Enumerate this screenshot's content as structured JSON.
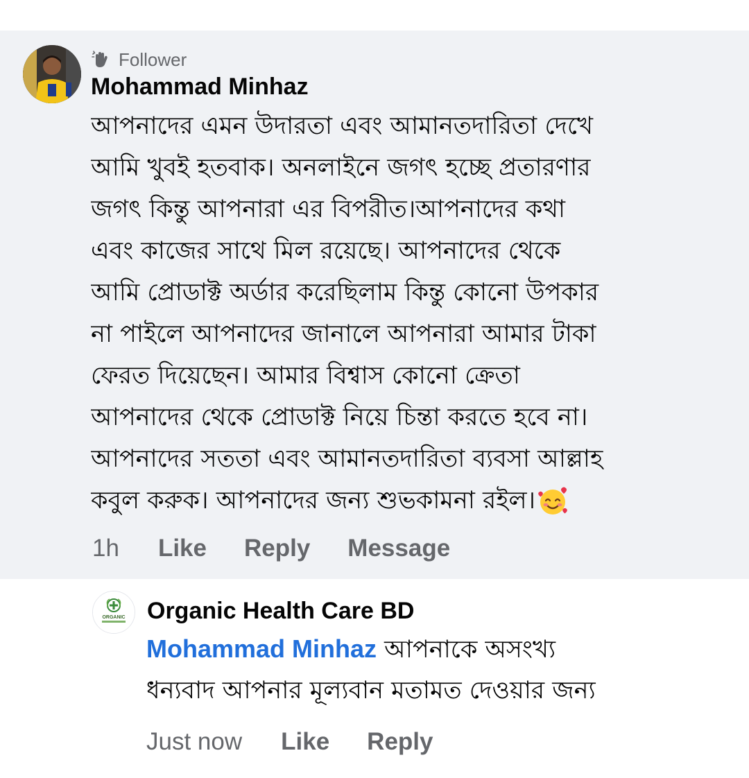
{
  "comment": {
    "badge": "Follower",
    "author": "Mohammad Minhaz",
    "lines": [
      "আপনাদের এমন উদারতা এবং আমানতদারিতা দেখে",
      "আমি খুবই হতবাক। অনলাইনে জগৎ হচ্ছে প্রতারণার",
      "জগৎ কিন্তু আপনারা এর বিপরীত।আপনাদের কথা",
      "এবং কাজের সাথে মিল রয়েছে। আপনাদের থেকে",
      "আমি প্রোডাক্ট অর্ডার করেছিলাম কিন্তু কোনো উপকার",
      "না পাইলে আপনাদের জানালে আপনারা আমার টাকা",
      "ফেরত দিয়েছেন। আমার বিশ্বাস কোনো ক্রেতা",
      "আপনাদের থেকে প্রোডাক্ট নিয়ে চিন্তা করতে হবে না।",
      "আপনাদের সততা এবং আমানতদারিতা ব্যবসা আল্লাহ",
      "কবুল করুক। আপনাদের জন্য শুভকামনা রইল।"
    ],
    "emoji": "smiling-face-with-hearts",
    "time": "1h",
    "like_label": "Like",
    "reply_label": "Reply",
    "message_label": "Message"
  },
  "reply": {
    "author": "Organic Health Care BD",
    "mention": "Mohammad Minhaz",
    "line1_text": " আপনাকে অসংখ্য",
    "line2_text": "ধন্যবাদ আপনার মূল্যবান মতামত দেওয়ার জন্য",
    "time": "Just now",
    "like_label": "Like",
    "reply_label": "Reply",
    "logo_text": "ORGANIC"
  },
  "colors": {
    "highlight_bg": "#f0f2f5",
    "text": "#050505",
    "secondary": "#65676b",
    "mention": "#216fdb"
  }
}
